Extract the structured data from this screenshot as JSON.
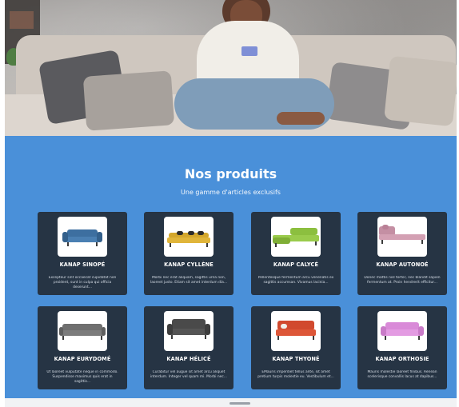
{
  "section": {
    "title": "Nos produits",
    "subtitle": "Une gamme d'articles exclusifs"
  },
  "products": [
    {
      "name": "KANAP SINOPÉ",
      "description": "Excepteur sint occaecat cupidatat non proident, sunt in culpa qui officia deserunt...",
      "color": "#3d6fa0"
    },
    {
      "name": "KANAP CYLLÈNE",
      "description": "Morbi nec erat aliquam, sagittis urna non, laoreet justo. Etiam sit amet interdum dia...",
      "color": "#d4a72c"
    },
    {
      "name": "KANAP CALYCÉ",
      "description": "Pellentesque fermentum arcu venenatis ex sagittis accumsan. Vivamus lacinia...",
      "color": "#8cbf3f"
    },
    {
      "name": "KANAP AUTONOÉ",
      "description": "Donec mattis nisl tortor, nec blandit sapien fermentum at. Proin hendrerit efficitur...",
      "color": "#c48fa3"
    },
    {
      "name": "KANAP EURYDOMÉ",
      "description": "Ut laoreet vulputate neque in commodo. Suspendisse maximus quis erat in sagittis...",
      "color": "#6f6f6f"
    },
    {
      "name": "KANAP HÉLICÉ",
      "description": "Curabitur vel augue sit amet arcu aliquet interdum. Integer vel quam mi. Morbi nec...",
      "color": "#4a4a4a"
    },
    {
      "name": "KANAP THYONÉ",
      "description": "EMauris imperdiet tellus ante, sit amet pretium turpis molestie eu. Vestibulum et...",
      "color": "#d1492e"
    },
    {
      "name": "KANAP ORTHOSIE",
      "description": "Mauris molestie laoreet finibus. Aenean scelerisque convallis lacus at dapibus...",
      "color": "#d98ad8"
    }
  ],
  "hero": {
    "icon": "hero-photo-woman-on-sofa"
  },
  "colors": {
    "section_bg": "#4a90d9",
    "card_bg": "#263444"
  }
}
